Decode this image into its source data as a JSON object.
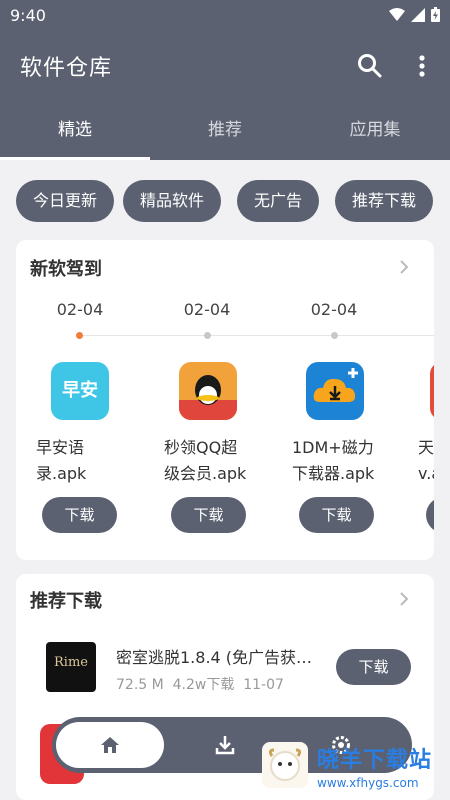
{
  "status": {
    "time": "9:40"
  },
  "appbar": {
    "title": "软件仓库"
  },
  "tabs": [
    {
      "label": "精选",
      "active": true
    },
    {
      "label": "推荐",
      "active": false
    },
    {
      "label": "应用集",
      "active": false
    }
  ],
  "chips": [
    "今日更新",
    "精品软件",
    "无广告",
    "推荐下载"
  ],
  "new_section": {
    "title": "新软驾到",
    "dates": [
      "02-04",
      "02-04",
      "02-04"
    ],
    "apps": [
      {
        "name_line1": "早安语",
        "name_line2": "录.apk",
        "icon_text": "早安",
        "button": "下载"
      },
      {
        "name_line1": "秒领QQ超",
        "name_line2": "级会员.apk",
        "button": "下载"
      },
      {
        "name_line1": "1DM+磁力",
        "name_line2": "下载器.apk",
        "button": "下载"
      },
      {
        "name_line1": "天",
        "name_line2": "v.a",
        "button": ""
      }
    ]
  },
  "recommend_section": {
    "title": "推荐下载",
    "item": {
      "icon_text": "Rime",
      "name": "密室逃脱1.8.4 (免广告获…",
      "size": "72.5 M",
      "downloads": "4.2w下载",
      "date": "11-07",
      "button": "下载"
    }
  },
  "bottom_nav": {
    "icons": [
      "home-icon",
      "download-icon",
      "settings-icon"
    ]
  },
  "watermark": {
    "text": "晓羊下载站",
    "url": "www.xfhygs.com"
  },
  "colors": {
    "primary": "#5b6170",
    "accent_dot": "#f07b3a",
    "background": "#f1f1f3"
  }
}
